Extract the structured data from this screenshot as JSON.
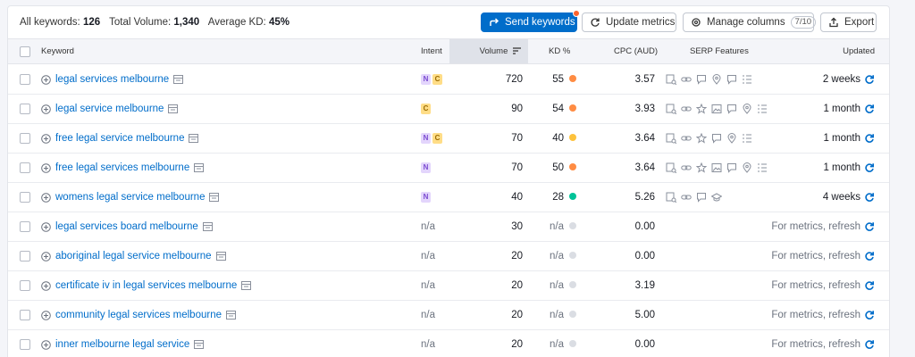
{
  "summary": {
    "all_keywords_label": "All keywords:",
    "all_keywords_value": "126",
    "total_volume_label": "Total Volume:",
    "total_volume_value": "1,340",
    "average_kd_label": "Average KD:",
    "average_kd_value": "45%"
  },
  "toolbar": {
    "send_keywords": "Send keywords",
    "update_metrics": "Update metrics",
    "manage_columns": "Manage columns",
    "columns_counter": "7/10",
    "export": "Export"
  },
  "columns": {
    "keyword": "Keyword",
    "intent": "Intent",
    "volume": "Volume",
    "kd": "KD %",
    "cpc": "CPC (AUD)",
    "serp": "SERP Features",
    "updated": "Updated"
  },
  "colors": {
    "accent": "#006dca",
    "kd_orange": "#ff8c43",
    "kd_yellow": "#fdc23c",
    "kd_green": "#00c398",
    "kd_none": "#dadde3"
  },
  "rows": [
    {
      "keyword": "legal services melbourne",
      "intent": [
        "N",
        "C"
      ],
      "volume": "720",
      "kd": "55",
      "kd_color": "#ff8c43",
      "cpc": "3.57",
      "serp": [
        "search-result-icon",
        "link-icon",
        "review-icon",
        "local-pack-icon",
        "review-icon",
        "list-icon"
      ],
      "updated": "2 weeks"
    },
    {
      "keyword": "legal service melbourne",
      "intent": [
        "C"
      ],
      "volume": "90",
      "kd": "54",
      "kd_color": "#ff8c43",
      "cpc": "3.93",
      "serp": [
        "search-result-icon",
        "link-icon",
        "star-icon",
        "image-icon",
        "review-icon",
        "local-pack-icon",
        "list-icon"
      ],
      "updated": "1 month"
    },
    {
      "keyword": "free legal service melbourne",
      "intent": [
        "N",
        "C"
      ],
      "volume": "70",
      "kd": "40",
      "kd_color": "#fdc23c",
      "cpc": "3.64",
      "serp": [
        "search-result-icon",
        "link-icon",
        "star-icon",
        "review-icon",
        "local-pack-icon",
        "list-icon"
      ],
      "updated": "1 month"
    },
    {
      "keyword": "free legal services melbourne",
      "intent": [
        "N"
      ],
      "volume": "70",
      "kd": "50",
      "kd_color": "#ff8c43",
      "cpc": "3.64",
      "serp": [
        "search-result-icon",
        "link-icon",
        "star-icon",
        "image-icon",
        "review-icon",
        "local-pack-icon",
        "list-icon"
      ],
      "updated": "1 month"
    },
    {
      "keyword": "womens legal service melbourne",
      "intent": [
        "N"
      ],
      "volume": "40",
      "kd": "28",
      "kd_color": "#00c398",
      "cpc": "5.26",
      "serp": [
        "search-result-icon",
        "link-icon",
        "review-icon",
        "graduation-cap-icon"
      ],
      "updated": "4 weeks"
    },
    {
      "keyword": "legal services board melbourne",
      "intent_text": "n/a",
      "volume": "30",
      "kd": "n/a",
      "kd_color": "#dadde3",
      "cpc": "0.00",
      "serp": [],
      "updated": "For metrics, refresh"
    },
    {
      "keyword": "aboriginal legal service melbourne",
      "intent_text": "n/a",
      "volume": "20",
      "kd": "n/a",
      "kd_color": "#dadde3",
      "cpc": "0.00",
      "serp": [],
      "updated": "For metrics, refresh"
    },
    {
      "keyword": "certificate iv in legal services melbourne",
      "intent_text": "n/a",
      "volume": "20",
      "kd": "n/a",
      "kd_color": "#dadde3",
      "cpc": "3.19",
      "serp": [],
      "updated": "For metrics, refresh"
    },
    {
      "keyword": "community legal services melbourne",
      "intent_text": "n/a",
      "volume": "20",
      "kd": "n/a",
      "kd_color": "#dadde3",
      "cpc": "5.00",
      "serp": [],
      "updated": "For metrics, refresh"
    },
    {
      "keyword": "inner melbourne legal service",
      "intent_text": "n/a",
      "volume": "20",
      "kd": "n/a",
      "kd_color": "#dadde3",
      "cpc": "0.00",
      "serp": [],
      "updated": "For metrics, refresh"
    }
  ]
}
